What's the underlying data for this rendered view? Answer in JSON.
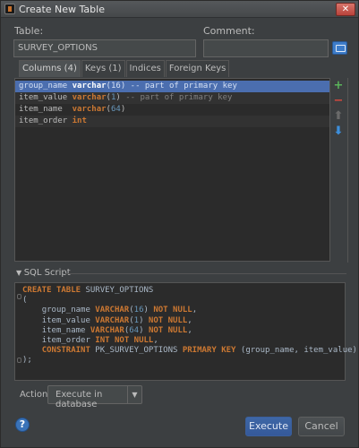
{
  "window": {
    "title": "Create New Table",
    "close_glyph": "✕"
  },
  "form": {
    "table_label": "Table:",
    "table_value": "SURVEY_OPTIONS",
    "comment_label": "Comment:",
    "comment_value": ""
  },
  "tabs": [
    {
      "label": "Columns (4)",
      "active": true
    },
    {
      "label": "Keys (1)",
      "active": false
    },
    {
      "label": "Indices",
      "active": false
    },
    {
      "label": "Foreign Keys",
      "active": false
    }
  ],
  "columns": [
    {
      "name": "group_name",
      "type": "varchar",
      "size": "(16)",
      "comment": " -- part of primary key",
      "selected": true
    },
    {
      "name": "item_value",
      "type": "varchar",
      "size": "(1)",
      "comment": " -- part of primary key",
      "selected": false
    },
    {
      "name": "item_name",
      "type": "varchar",
      "size": "(64)",
      "comment": "",
      "selected": false
    },
    {
      "name": "item_order",
      "type": "int",
      "size": "",
      "comment": "",
      "selected": false
    }
  ],
  "side_tools": [
    {
      "name": "add-icon",
      "glyph": "+",
      "color": "#5ab55a"
    },
    {
      "name": "remove-icon",
      "glyph": "−",
      "color": "#d24a3f"
    },
    {
      "name": "move-up-icon",
      "glyph": "⬆",
      "color": "#6a6a6a"
    },
    {
      "name": "move-down-icon",
      "glyph": "⬇",
      "color": "#3d8fdc"
    }
  ],
  "sql": {
    "header": "SQL Script",
    "lines": [
      "CREATE TABLE SURVEY_OPTIONS",
      "(",
      "    group_name VARCHAR(16) NOT NULL,",
      "    item_value VARCHAR(1) NOT NULL,",
      "    item_name VARCHAR(64) NOT NULL,",
      "    item_order INT NOT NULL,",
      "    CONSTRAINT PK_SURVEY_OPTIONS PRIMARY KEY (group_name, item_value)",
      ");"
    ]
  },
  "action": {
    "label": "Action:",
    "value": "Execute in database"
  },
  "buttons": {
    "help": "?",
    "execute": "Execute",
    "cancel": "Cancel"
  },
  "colors": {
    "background": "#3c3f41",
    "selection": "#4b6eaf",
    "keyword": "#cc7832",
    "number": "#6897bb"
  }
}
